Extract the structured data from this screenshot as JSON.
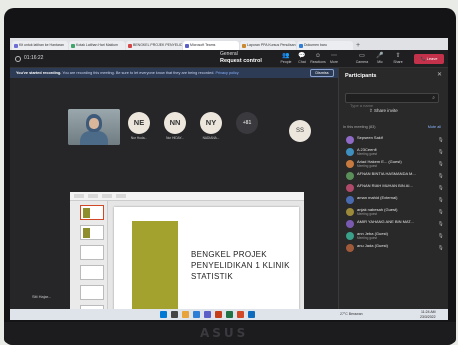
{
  "browser": {
    "tabs": [
      {
        "label": "Kit untuk latihan ke Hantaran",
        "active": false,
        "color": "#6d6dd6"
      },
      {
        "label": "Kotak Latihan Hari Maklum",
        "active": false,
        "color": "#3fa56b"
      },
      {
        "label": "BENGKEL PROJEK PENYELIDIKAN",
        "active": false,
        "color": "#d64545"
      },
      {
        "label": "Microsoft Teams",
        "active": true,
        "color": "#5b5fc7"
      },
      {
        "label": "Laporan PPA Kursus Penulisan",
        "active": false,
        "color": "#c98a2e"
      },
      {
        "label": "Dokumen baru",
        "active": false,
        "color": "#2e7dd6"
      }
    ],
    "new_tab": "+"
  },
  "meeting": {
    "title": "General",
    "timer": "01:16:22",
    "request_control": "Request control",
    "toolbar": [
      {
        "label": "People",
        "icon": "people-icon",
        "glyph": "👥"
      },
      {
        "label": "Chat",
        "icon": "chat-icon",
        "glyph": "💬"
      },
      {
        "label": "Reactions",
        "icon": "reactions-icon",
        "glyph": "☺"
      },
      {
        "label": "More",
        "icon": "more-icon",
        "glyph": "⋯"
      },
      {
        "label": "Camera",
        "icon": "camera-icon",
        "glyph": "▭"
      },
      {
        "label": "Mic",
        "icon": "mic-icon",
        "glyph": "🎤"
      },
      {
        "label": "Share",
        "icon": "share-icon",
        "glyph": "⇧"
      }
    ],
    "leave": "Leave"
  },
  "banner": {
    "strong": "You've started recording.",
    "text": " You are recording this meeting. Be sure to let everyone know that they are being recorded. ",
    "link": "Privacy policy",
    "dismiss": "Dismiss"
  },
  "participants_strip": [
    {
      "initials": "NE",
      "name": "Nur Huda..."
    },
    {
      "initials": "NN",
      "name": "Nur HIDAY..."
    },
    {
      "initials": "NY",
      "name": "NADIANA..."
    },
    {
      "initials": "+81",
      "name": ""
    }
  ],
  "ss_avatar": "SS",
  "slide": {
    "title": "BENGKEL PROJEK PENYELIDIKAN 1 KLINIK STATISTIK"
  },
  "self_label": "Siti Hajar...",
  "people_panel": {
    "title": "Participants",
    "search_placeholder": "Type a name",
    "share_invite": "Share invite",
    "section": "In this meeting (83)",
    "mute_all": "Mute all",
    "people": [
      {
        "name": "Sepseen Sakif",
        "sub": "",
        "color": "#8f6bc7"
      },
      {
        "name": "A 23Ceenfi",
        "sub": "Meeting guest",
        "color": "#3f8fbf"
      },
      {
        "name": "Ariad Hakem E... (Guest)",
        "sub": "Meeting guest",
        "color": "#c77a3f"
      },
      {
        "name": "AFNAN BINTIA HASMANDA M...",
        "sub": "",
        "color": "#5a8f5a"
      },
      {
        "name": "AFNAN RIAH MUHAN BIN AI...",
        "sub": "",
        "color": "#b04a6a"
      },
      {
        "name": "aman mahid (External)",
        "sub": "",
        "color": "#4a6ab0"
      },
      {
        "name": "anjak nabesah (Guest)",
        "sub": "Meeting guest",
        "color": "#9a8a3a"
      },
      {
        "name": "AMIR YAHANG ANE BIN MAT...",
        "sub": "",
        "color": "#7a5ab0"
      },
      {
        "name": "ann Jeba (Guest)",
        "sub": "Meeting guest",
        "color": "#3aa08a"
      },
      {
        "name": "anu Jada (Guest)",
        "sub": "",
        "color": "#a05a3a"
      }
    ]
  },
  "taskbar": {
    "tray": "27°C Berawan",
    "time": "11:24 AM",
    "date": "23/3/2022"
  },
  "brand": "ASUS"
}
